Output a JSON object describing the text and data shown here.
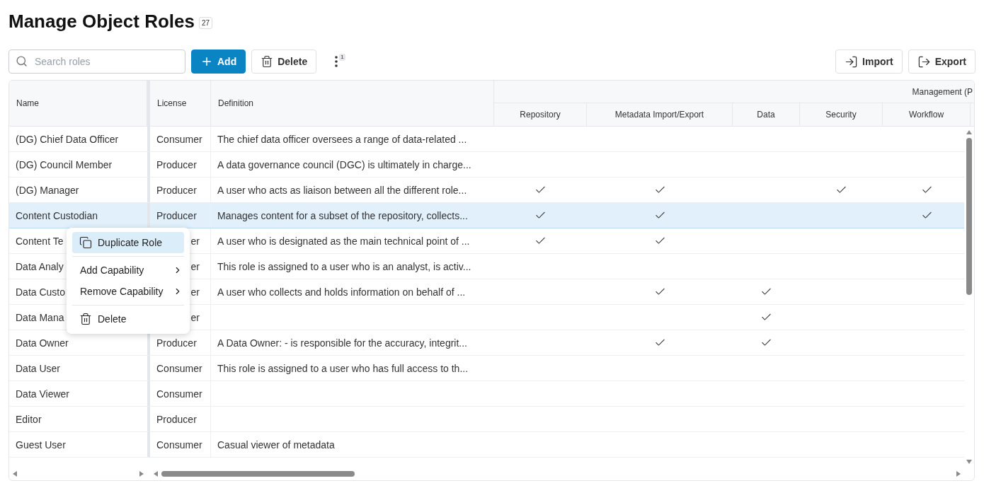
{
  "title": "Manage Object Roles",
  "count": "27",
  "toolbar": {
    "search": {
      "placeholder": "Search roles"
    },
    "add": "Add",
    "delete": "Delete",
    "more_badge": "1",
    "import": "Import",
    "export": "Export"
  },
  "table": {
    "columns": [
      "Name",
      "License",
      "Definition"
    ],
    "group": "Management (P",
    "sub_columns": [
      "Repository",
      "Metadata Import/Export",
      "Data",
      "Security",
      "Workflow"
    ],
    "rows": [
      {
        "name": "(DG) Chief Data Officer",
        "license": "Consumer",
        "definition": "The chief data officer oversees a range of data-related ...",
        "checks": [
          false,
          false,
          false,
          false,
          false
        ],
        "selected": false,
        "covered": false
      },
      {
        "name": "(DG) Council Member",
        "license": "Producer",
        "definition": "A data governance council (DGC) is ultimately in charge...",
        "checks": [
          false,
          false,
          false,
          false,
          false
        ],
        "selected": false,
        "covered": false
      },
      {
        "name": "(DG) Manager",
        "license": "Producer",
        "definition": "A user who acts as liaison between all the different role...",
        "checks": [
          true,
          true,
          false,
          true,
          true
        ],
        "selected": false,
        "covered": false
      },
      {
        "name": "Content Custodian",
        "license": "Producer",
        "definition": "Manages content for a subset of the repository, collects...",
        "checks": [
          true,
          true,
          false,
          false,
          true
        ],
        "selected": true,
        "covered": false
      },
      {
        "name": "Content Te",
        "license": "er",
        "definition": "A user who is designated as the main technical point of ...",
        "checks": [
          true,
          true,
          false,
          false,
          false
        ],
        "selected": false,
        "covered": true
      },
      {
        "name": "Data Analy",
        "license": "er",
        "definition": "This role is assigned to a user who is an analyst, is activ...",
        "checks": [
          false,
          false,
          false,
          false,
          false
        ],
        "selected": false,
        "covered": true
      },
      {
        "name": "Data Custo",
        "license": "er",
        "definition": "A user who collects and holds information on behalf of ...",
        "checks": [
          false,
          true,
          true,
          false,
          false
        ],
        "selected": false,
        "covered": true
      },
      {
        "name": "Data Mana",
        "license": "er",
        "checks": [
          false,
          false,
          true,
          false,
          false
        ],
        "selected": false,
        "covered": true
      },
      {
        "name": "Data Owner",
        "license": "Producer",
        "definition": "A Data Owner: - is responsible for the accuracy, integrit...",
        "checks": [
          false,
          true,
          true,
          false,
          false
        ],
        "selected": false,
        "covered": false
      },
      {
        "name": "Data User",
        "license": "Consumer",
        "definition": "This role is assigned to a user who has full access to th...",
        "checks": [
          false,
          false,
          false,
          false,
          false
        ],
        "selected": false,
        "covered": false
      },
      {
        "name": "Data Viewer",
        "license": "Consumer",
        "checks": [
          false,
          false,
          false,
          false,
          false
        ],
        "selected": false,
        "covered": false
      },
      {
        "name": "Editor",
        "license": "Producer",
        "checks": [
          false,
          false,
          false,
          false,
          false
        ],
        "selected": false,
        "covered": false
      },
      {
        "name": "Guest User",
        "license": "Consumer",
        "definition": "Casual viewer of metadata",
        "checks": [
          false,
          false,
          false,
          false,
          false
        ],
        "selected": false,
        "covered": false
      }
    ]
  },
  "context_menu": {
    "groups": [
      [
        {
          "label": "Duplicate Role",
          "kind": "copy",
          "selected": true
        }
      ],
      [
        {
          "label": "Add Capability",
          "kind": "submenu",
          "selected": false
        },
        {
          "label": "Remove Capability",
          "kind": "submenu",
          "selected": false
        }
      ],
      [
        {
          "label": "Delete",
          "kind": "trash",
          "selected": false
        }
      ]
    ]
  }
}
